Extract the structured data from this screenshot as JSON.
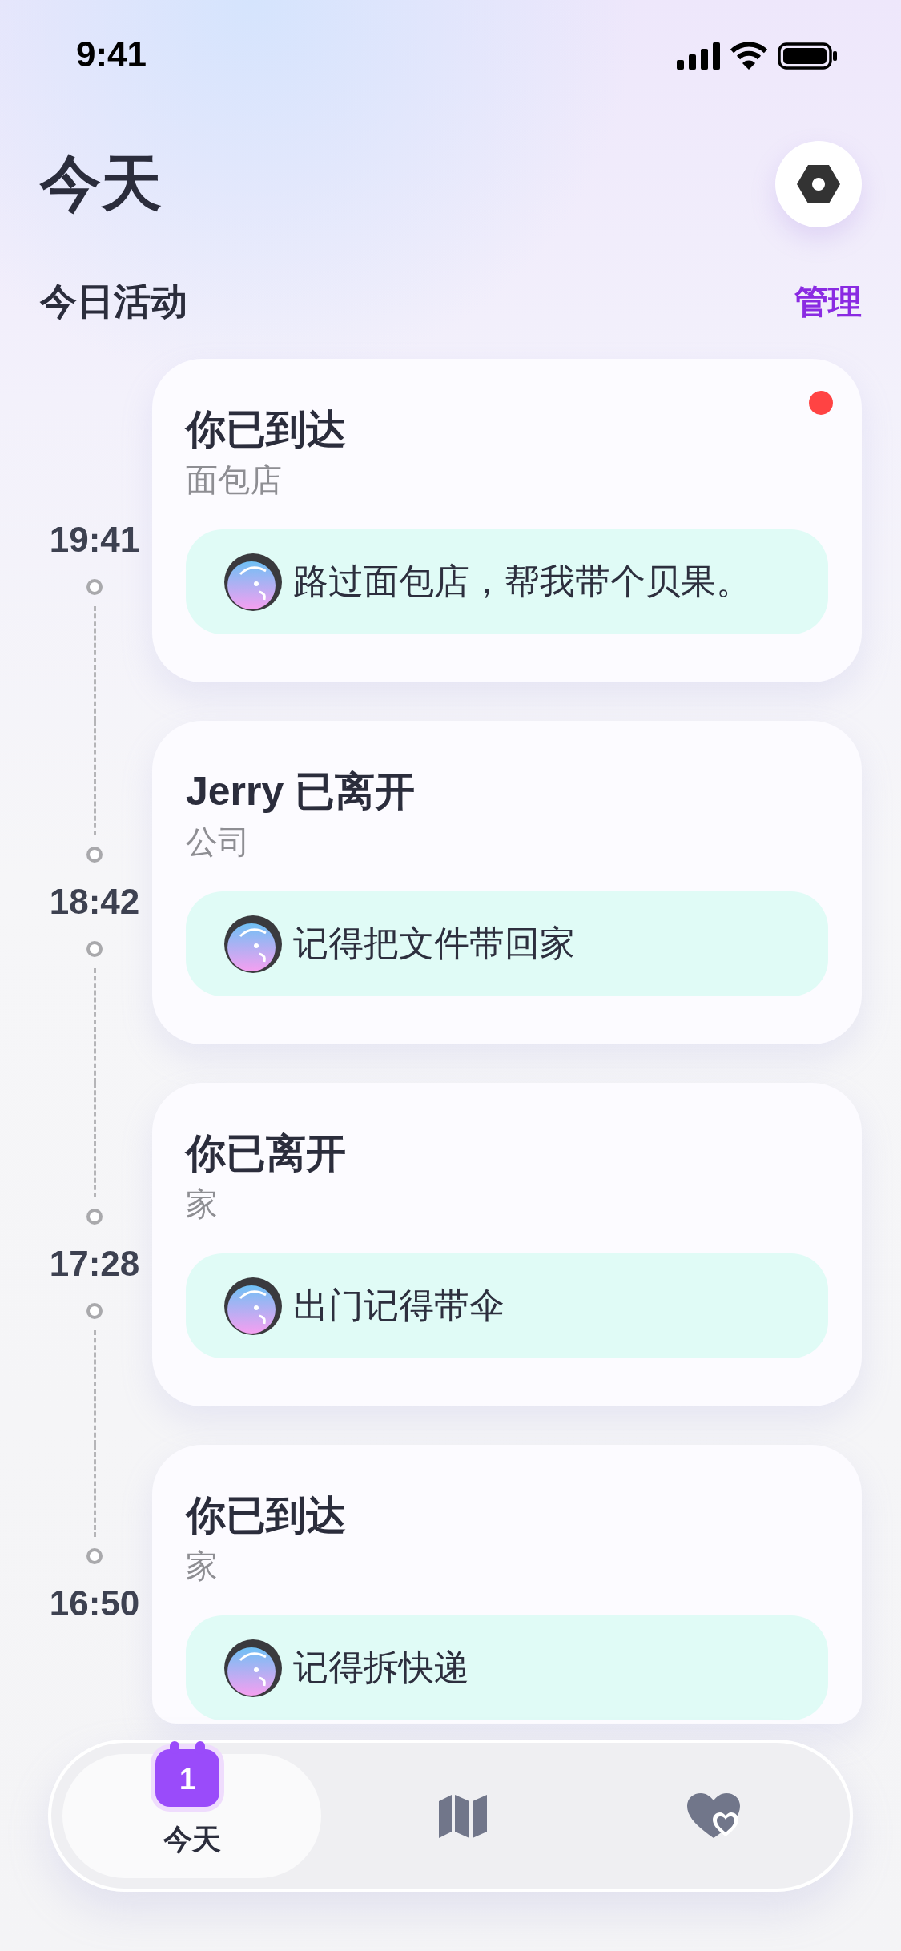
{
  "status_bar": {
    "time": "9:41"
  },
  "header": {
    "title": "今天"
  },
  "section": {
    "title": "今日活动",
    "action": "管理"
  },
  "events": [
    {
      "time": "19:41",
      "title": "你已到达",
      "place": "面包店",
      "note": "路过面包店，帮我带个贝果。",
      "unread": true
    },
    {
      "time": "18:42",
      "title": "Jerry 已离开",
      "place": "公司",
      "note": "记得把文件带回家",
      "unread": false
    },
    {
      "time": "17:28",
      "title": "你已离开",
      "place": "家",
      "note": "出门记得带伞",
      "unread": false
    },
    {
      "time": "16:50",
      "title": "你已到达",
      "place": "家",
      "note": "记得拆快递",
      "unread": false
    }
  ],
  "tab_bar": {
    "tabs": [
      {
        "kind": "calendar",
        "label": "今天",
        "badge": "1",
        "selected": true
      },
      {
        "kind": "map",
        "selected": false
      },
      {
        "kind": "heart",
        "selected": false
      }
    ]
  }
}
